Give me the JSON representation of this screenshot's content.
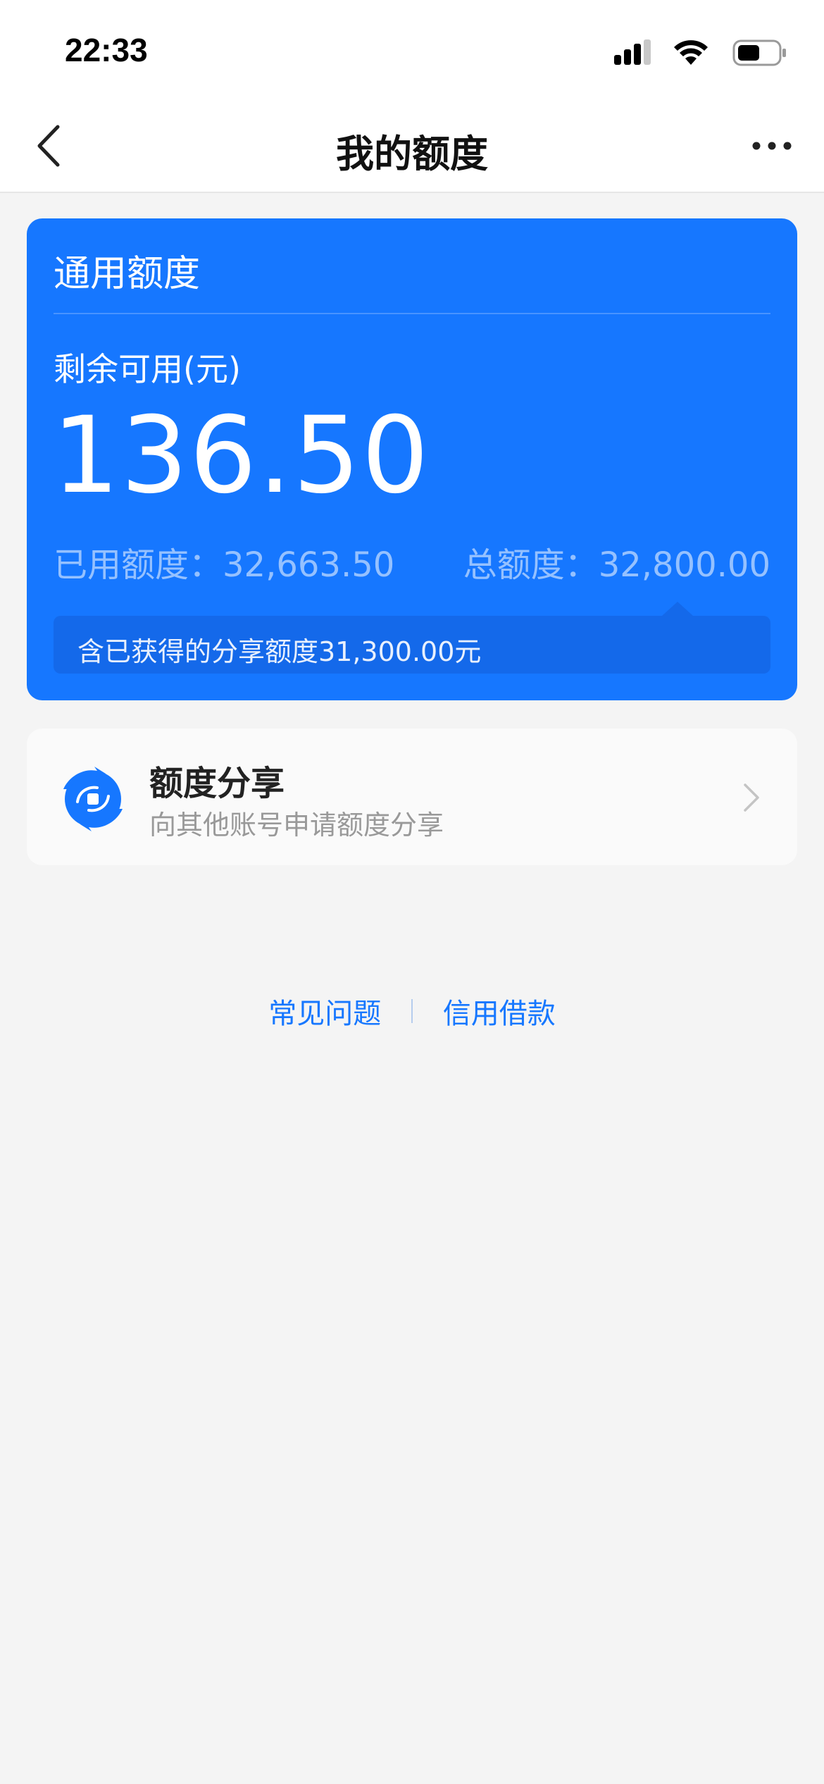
{
  "status_bar": {
    "time": "22:33",
    "icons": [
      "signal-icon",
      "wifi-icon",
      "battery-icon"
    ]
  },
  "nav": {
    "title": "我的额度",
    "back_icon": "chevron-left-icon",
    "more_icon": "more-dots-icon"
  },
  "quota_card": {
    "title": "通用额度",
    "available_label": "剩余可用(元)",
    "available_amount": "136.50",
    "used_label": "已用额度：",
    "used_value": "32,663.50",
    "total_label": "总额度：",
    "total_value": "32,800.00",
    "share_note": "含已获得的分享额度31,300.00元"
  },
  "share_entry": {
    "title": "额度分享",
    "subtitle": "向其他账号申请额度分享",
    "icon": "share-exchange-icon"
  },
  "footer": {
    "faq_label": "常见问题",
    "loan_label": "信用借款"
  },
  "colors": {
    "accent": "#1677ff",
    "background": "#f4f4f4",
    "card_text": "#ffffff"
  }
}
